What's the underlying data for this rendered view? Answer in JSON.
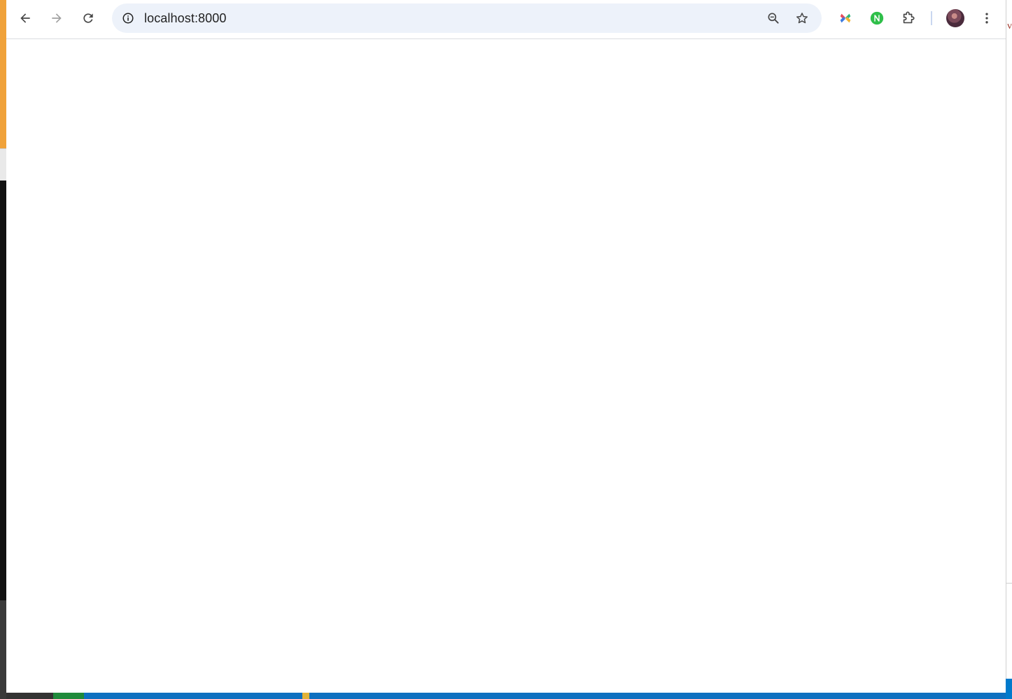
{
  "address_bar": {
    "url_host": "localhost",
    "url_port": ":8000"
  },
  "background_window": {
    "right_edge_text": "v"
  },
  "icons": {
    "back": "arrow-left-icon",
    "forward": "arrow-right-icon",
    "reload": "reload-icon",
    "site_info": "info-circle-icon",
    "zoom": "zoom-out-icon",
    "bookmark": "star-icon",
    "extension_1": "colorful-x-extension-icon",
    "extension_2": "green-n-extension-icon",
    "extensions_menu": "puzzle-piece-icon",
    "profile": "avatar",
    "more_menu": "kebab-menu-icon"
  },
  "colors": {
    "toolbar_bg": "#ffffff",
    "omnibox_bg": "#edf2fa",
    "icon": "#474747",
    "disabled_icon": "#a0a0a0",
    "page_bg": "#ffffff"
  }
}
